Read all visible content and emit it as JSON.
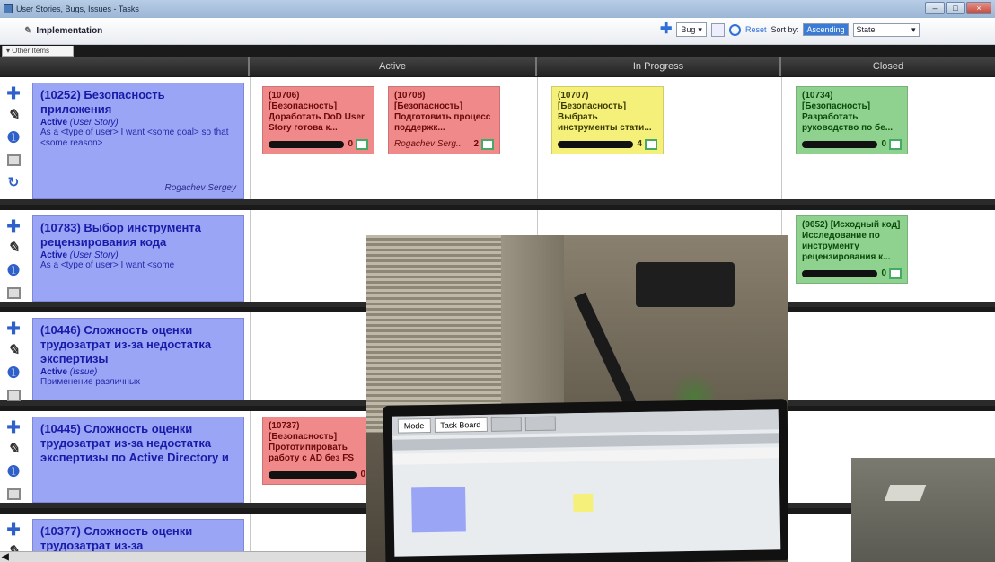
{
  "window": {
    "title": "User Stories, Bugs, Issues - Tasks"
  },
  "toolbar": {
    "group_label": "Implementation",
    "new_type": "Bug",
    "reset_label": "Reset",
    "sort_label": "Sort by:",
    "sort_order": "Ascending",
    "sort_field": "State"
  },
  "other_items_label": "Other Items",
  "columns": [
    "Active",
    "In Progress",
    "Closed"
  ],
  "stories": [
    {
      "title": "(10252) Безопасность приложения",
      "state": "Active",
      "type": "(User Story)",
      "desc": "As a <type of user> I want <some goal> so that <some reason>",
      "owner": "Rogachev Sergey"
    },
    {
      "title": "(10783) Выбор инструмента рецензирования кода",
      "state": "Active",
      "type": "(User Story)",
      "desc": "As a <type of user> I want <some"
    },
    {
      "title": "(10446) Сложность оценки трудозатрат из-за недостатка экспертизы",
      "state": "Active",
      "type": "(Issue)",
      "desc": "Применение различных"
    },
    {
      "title": "(10445) Сложность оценки трудозатрат из-за недостатка экспертизы по Active Directory и"
    },
    {
      "title": "(10377) Сложность оценки трудозатрат из-за"
    }
  ],
  "cards": [
    {
      "id": "(10706)",
      "text": "[Безопасность] Доработать DoD User Story готова к...",
      "count": "0",
      "color": "red"
    },
    {
      "id": "(10708)",
      "text": "[Безопасность] Подготовить процесс поддержк...",
      "assignee": "Rogachev Serg...",
      "count": "2",
      "color": "red"
    },
    {
      "id": "(10707)",
      "text": "[Безопасность] Выбрать инструменты стати...",
      "count": "4",
      "color": "yellow"
    },
    {
      "id": "(10734)",
      "text": "[Безопасность] Разработать руководство по бе...",
      "count": "0",
      "color": "green"
    },
    {
      "id": "(9652)",
      "text": "[Исходный код] Исследование по инструменту рецензирования к...",
      "count": "0",
      "color": "green"
    },
    {
      "id": "(10737)",
      "text": "[Безопасность] Прототипировать работу с AD без FS",
      "count": "0",
      "color": "red"
    }
  ],
  "photo_screen": {
    "tab_mode": "Mode",
    "tab_board": "Task Board"
  },
  "colors": {
    "story_blue": "#9aa6f5",
    "card_red": "#f08a8a",
    "card_yellow": "#f5f07a",
    "card_green": "#8fd18f",
    "header_dark": "#2a2a2a"
  }
}
